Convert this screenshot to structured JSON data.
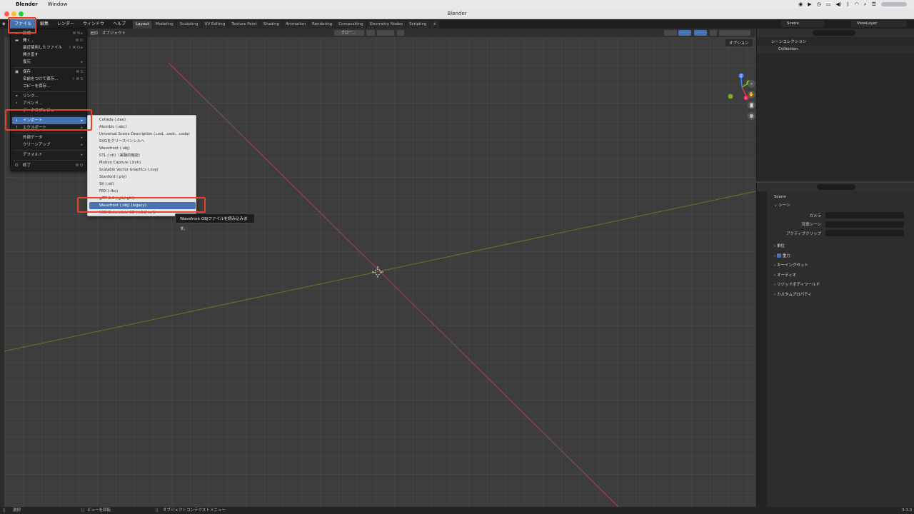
{
  "mac_menubar": {
    "app_name": "Blender",
    "menu_window": "Window"
  },
  "window": {
    "title": "Blender"
  },
  "menubar": {
    "items": [
      "ファイル",
      "編集",
      "レンダー",
      "ウィンドウ",
      "ヘルプ"
    ],
    "workspaces": [
      "Layout",
      "Modeling",
      "Sculpting",
      "UV Editing",
      "Texture Paint",
      "Shading",
      "Animation",
      "Rendering",
      "Compositing",
      "Geometry Nodes",
      "Scripting"
    ],
    "add_tab": "+",
    "scene_label": "Scene",
    "view_layer_label": "ViewLayer"
  },
  "viewport_header": {
    "add": "追加",
    "object": "オブジェクト",
    "transform_orientation": "グロー...",
    "option_button": "オプション"
  },
  "gizmo": {
    "x": "X",
    "y": "Y",
    "z": "Z"
  },
  "file_menu": {
    "items": [
      {
        "label": "新規",
        "shortcut": "⌘ N ▸"
      },
      {
        "label": "開く...",
        "shortcut": "⌘ O"
      },
      {
        "label": "最近使用したファイル",
        "shortcut": "⇧ ⌘ O ▸"
      },
      {
        "label": "開き直す",
        "shortcut": ""
      },
      {
        "label": "復元",
        "shortcut": "▸"
      },
      {
        "label": "保存",
        "shortcut": "⌘ S"
      },
      {
        "label": "名前をつけて保存...",
        "shortcut": "⇧ ⌘ S"
      },
      {
        "label": "コピーを保存...",
        "shortcut": ""
      },
      {
        "label": "リンク...",
        "shortcut": ""
      },
      {
        "label": "アペンド...",
        "shortcut": ""
      },
      {
        "label": "データのプレビュー",
        "shortcut": ""
      },
      {
        "label": "インポート",
        "shortcut": "▸"
      },
      {
        "label": "エクスポート",
        "shortcut": "▸"
      },
      {
        "label": "外部データ",
        "shortcut": "▸"
      },
      {
        "label": "クリーンアップ",
        "shortcut": "▸"
      },
      {
        "label": "デフォルト",
        "shortcut": "▸"
      },
      {
        "label": "終了",
        "shortcut": "⌘ Q"
      }
    ]
  },
  "import_menu": {
    "items": [
      "Collada (.dae)",
      "Alembic (.abc)",
      "Universal Scene Description (.usd, .usdc, .usda)",
      "SVGをグリースペンシルへ",
      "Wavefront (.obj)",
      "STL (.stl)（実験的機能）",
      "Motion Capture (.bvh)",
      "Scalable Vector Graphics (.svg)",
      "Stanford (.ply)",
      "Stl (.stl)",
      "FBX (.fbx)",
      "glTF 2.0 (.glb/.gltf)",
      "Wavefront (.obj) (legacy)",
      "X3D Extensible 3D (.x3d/.wrl)"
    ],
    "highlighted_index": 12
  },
  "tooltip": {
    "text": "Wavefront OBJファイルを読み込みます。"
  },
  "outliner": {
    "scene_collection": "シーンコレクション",
    "collection": "Collection"
  },
  "properties": {
    "scene_name": "Scene",
    "section_scene": "シーン",
    "fields": [
      {
        "label": "カメラ"
      },
      {
        "label": "背景シーン"
      },
      {
        "label": "アクティブクリップ"
      }
    ],
    "sections": [
      "単位",
      "重力",
      "キーイングセット",
      "オーディオ",
      "リジッドボディワールド",
      "カスタムプロパティ"
    ]
  },
  "statusbar": {
    "select": "選択",
    "rotate_view": "ビューを回転",
    "context_menu": "オブジェクトコンテクストメニュー",
    "version": "3.3.0"
  },
  "colors": {
    "highlight": "#4772b3",
    "annotation_red": "#e8432a",
    "x_axis": "#b0404a",
    "y_axis": "#6a8a2a"
  }
}
